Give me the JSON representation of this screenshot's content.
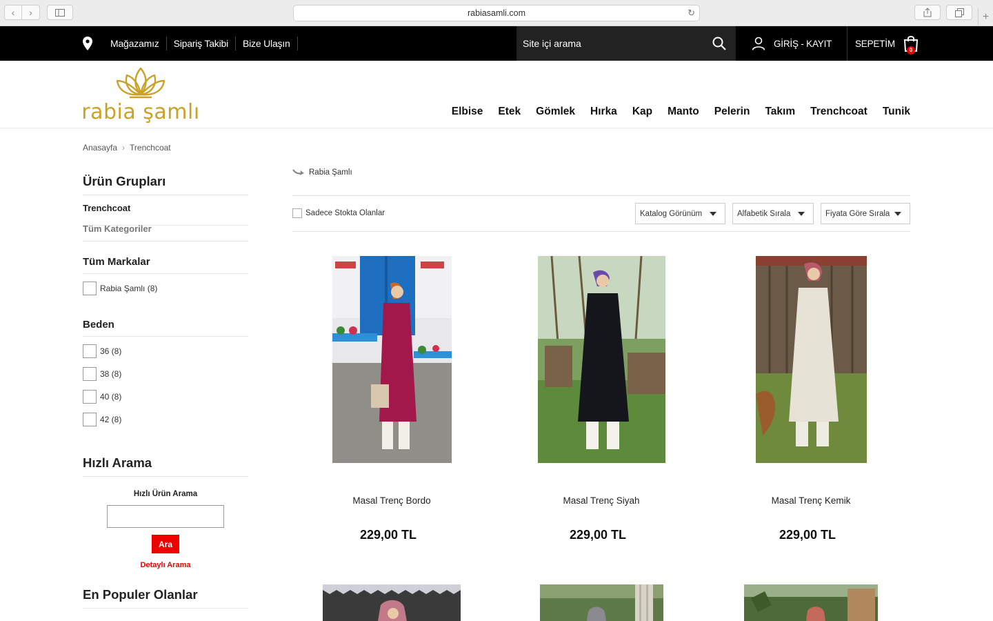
{
  "browser": {
    "url": "rabiasamli.com"
  },
  "topbar": {
    "links": [
      "Mağazamız",
      "Sipariş Takibi",
      "Bize Ulaşın"
    ],
    "search_placeholder": "Site içi arama",
    "login_label": "GİRİŞ - KAYIT",
    "cart_label": "SEPETİM",
    "cart_count": "0"
  },
  "header": {
    "logo_text": "rabia şamlı",
    "nav": [
      "Elbise",
      "Etek",
      "Gömlek",
      "Hırka",
      "Kap",
      "Manto",
      "Pelerin",
      "Takım",
      "Trenchcoat",
      "Tunik"
    ]
  },
  "breadcrumb": [
    "Anasayfa",
    "Trenchcoat"
  ],
  "sidebar": {
    "groups_title": "Ürün Grupları",
    "current_category": "Trenchcoat",
    "all_categories": "Tüm Kategoriler",
    "brands_title": "Tüm Markalar",
    "brands": [
      "Rabia Şamlı (8)"
    ],
    "size_title": "Beden",
    "sizes": [
      "36 (8)",
      "38 (8)",
      "40 (8)",
      "42 (8)"
    ],
    "quick_title": "Hızlı Arama",
    "quick_label": "Hızlı Ürün Arama",
    "quick_button": "Ara",
    "detailed_search": "Detaylı Arama",
    "popular_title": "En Populer Olanlar"
  },
  "listing": {
    "brand": "Rabia Şamlı",
    "stock_only": "Sadece Stokta Olanlar",
    "view_select": "Katalog Görünüm",
    "alpha_select": "Alfabetik Sırala",
    "price_select": "Fiyata Göre Sırala"
  },
  "products": [
    {
      "name": "Masal Trenç Bordo",
      "price": "229,00 TL",
      "coat_color": "#a3184a"
    },
    {
      "name": "Masal Trenç Siyah",
      "price": "229,00 TL",
      "coat_color": "#15161c"
    },
    {
      "name": "Masal Trenç Kemik",
      "price": "229,00 TL",
      "coat_color": "#e6e3d6"
    }
  ],
  "colors": {
    "accent": "#ee0000",
    "logo_gold": "#c9a227"
  }
}
